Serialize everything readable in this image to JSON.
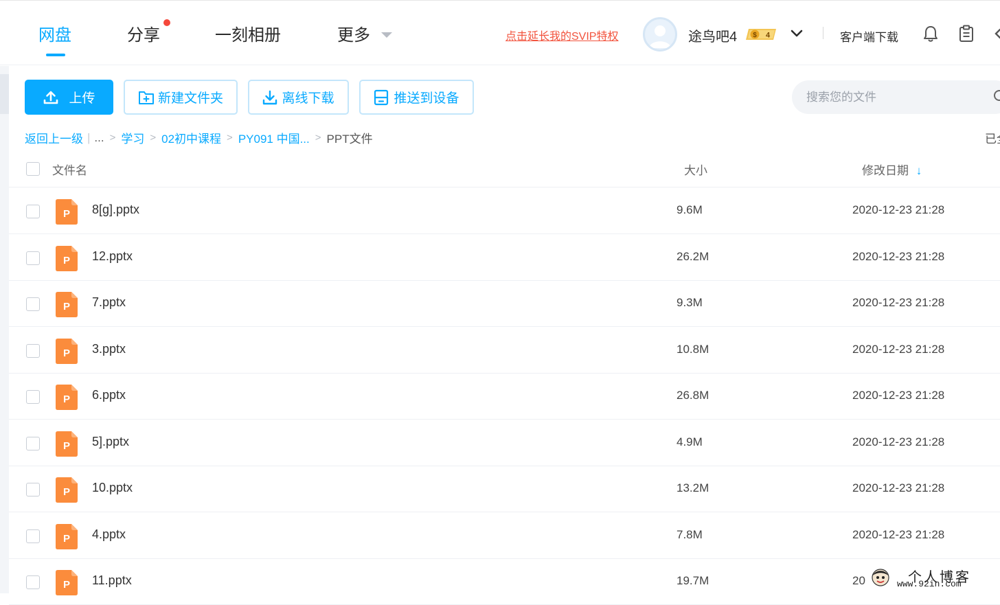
{
  "nav": {
    "tabs": [
      {
        "label": "网盘",
        "active": true
      },
      {
        "label": "分享",
        "has_notification": true
      },
      {
        "label": "一刻相册"
      },
      {
        "label": "更多"
      }
    ],
    "svip_link": "点击延长我的SVIP特权",
    "username": "途鸟吧4",
    "level_badge": "4",
    "client_download": "客户端下载",
    "icons": [
      "bell-icon",
      "clipboard-icon",
      "chevron-down-icon"
    ]
  },
  "toolbar": {
    "upload": "上传",
    "new_folder": "新建文件夹",
    "offline_download": "离线下载",
    "push_to_device": "推送到设备",
    "search_placeholder": "搜索您的文件"
  },
  "breadcrumb": {
    "back": "返回上一级",
    "ellipsis": "...",
    "items": [
      "学习",
      "02初中课程",
      "PY091 中国..."
    ],
    "current": "PPT文件",
    "status": "已全"
  },
  "table": {
    "headers": {
      "name": "文件名",
      "size": "大小",
      "date": "修改日期",
      "sort_indicator": "↓"
    },
    "rows": [
      {
        "name": "8[g].pptx",
        "size": "9.6M",
        "date": "2020-12-23 21:28"
      },
      {
        "name": "12.pptx",
        "size": "26.2M",
        "date": "2020-12-23 21:28"
      },
      {
        "name": "7.pptx",
        "size": "9.3M",
        "date": "2020-12-23 21:28"
      },
      {
        "name": "3.pptx",
        "size": "10.8M",
        "date": "2020-12-23 21:28"
      },
      {
        "name": "6.pptx",
        "size": "26.8M",
        "date": "2020-12-23 21:28"
      },
      {
        "name": "5].pptx",
        "size": "4.9M",
        "date": "2020-12-23 21:28"
      },
      {
        "name": "10.pptx",
        "size": "13.2M",
        "date": "2020-12-23 21:28"
      },
      {
        "name": "4.pptx",
        "size": "7.8M",
        "date": "2020-12-23 21:28"
      },
      {
        "name": "11.pptx",
        "size": "19.7M",
        "date": "20"
      }
    ]
  },
  "file_icon_letter": "P",
  "colors": {
    "accent": "#09aaff",
    "svip": "#f2533d",
    "ppt": "#fb8c3c"
  },
  "watermark": {
    "line1": "个人博客",
    "line2": "www.92in.com"
  }
}
